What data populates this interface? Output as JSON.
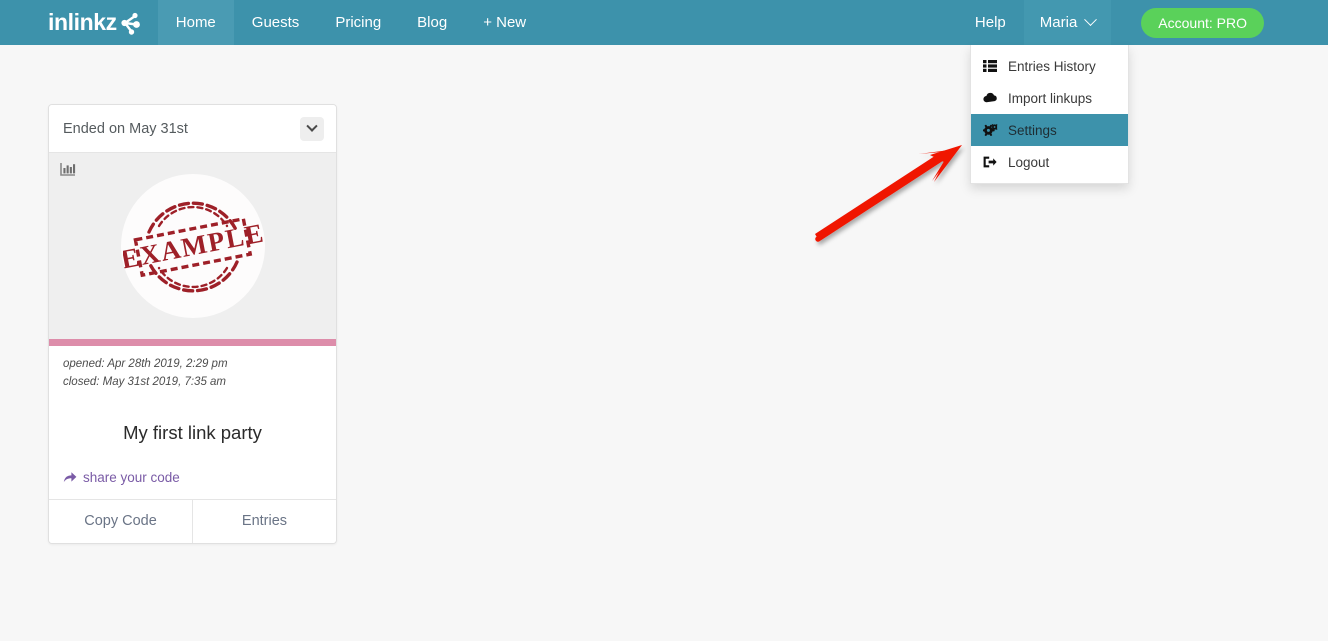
{
  "navbar": {
    "brand": "inlinkz",
    "brand_icon": "inlinkz-node-logo",
    "items": [
      {
        "label": "Home",
        "active": true
      },
      {
        "label": "Guests",
        "active": false
      },
      {
        "label": "Pricing",
        "active": false
      },
      {
        "label": "Blog",
        "active": false
      },
      {
        "label": "+ New",
        "active": false
      }
    ],
    "help_label": "Help",
    "user_label": "Maria",
    "user_caret_icon": "chevron-down-icon",
    "account_label": "Account: PRO",
    "bg_color": "#3d92ab",
    "account_color": "#5ad15a"
  },
  "user_menu": {
    "items": [
      {
        "label": "Entries History",
        "icon": "list-table-icon",
        "selected": false
      },
      {
        "label": "Import linkups",
        "icon": "cloud-download-icon",
        "selected": false
      },
      {
        "label": "Settings",
        "icon": "gears-icon",
        "selected": true
      },
      {
        "label": "Logout",
        "icon": "sign-out-icon",
        "selected": false
      }
    ],
    "highlight_color": "#3d92ab"
  },
  "card": {
    "header_title": "Ended on May 31st",
    "collapse_icon": "chevron-down-icon",
    "stats_icon": "bar-chart-icon",
    "image_alt": "EXAMPLE",
    "stamp_text": "EXAMPLE",
    "accent_bar_color": "#dd8daa",
    "opened": "opened: Apr 28th 2019, 2:29 pm",
    "closed": "closed: May 31st 2019, 7:35 am",
    "title": "My first link party",
    "share_label": "share your code",
    "share_icon": "share-arrow-icon",
    "footer": [
      {
        "label": "Copy Code"
      },
      {
        "label": "Entries"
      }
    ]
  },
  "annotation": {
    "arrow_color": "#f01400",
    "arrow_name": "red-pointer-arrow"
  }
}
